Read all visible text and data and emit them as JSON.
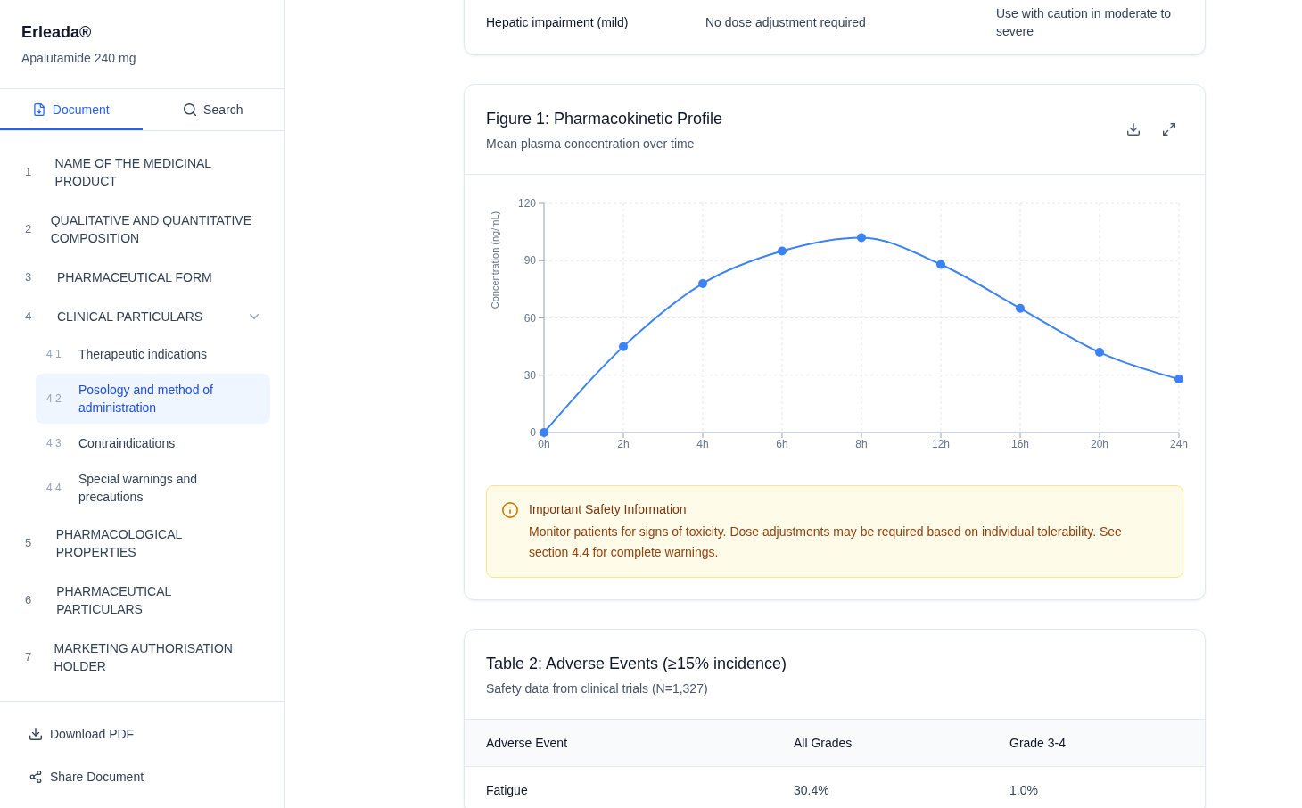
{
  "sidebar": {
    "title": "Erleada®",
    "subtitle": "Apalutamide 240 mg",
    "tabs": [
      {
        "label": "Document",
        "selected": true
      },
      {
        "label": "Search",
        "selected": false
      }
    ],
    "sections": [
      {
        "number": "1",
        "title": "NAME OF THE MEDICINAL PRODUCT",
        "selected": false
      },
      {
        "number": "2",
        "title": "QUALITATIVE AND QUANTITATIVE COMPOSITION",
        "selected": false
      },
      {
        "number": "3",
        "title": "PHARMACEUTICAL FORM",
        "selected": false
      },
      {
        "number": "4",
        "title": "CLINICAL PARTICULARS",
        "selected": false,
        "expanded": true,
        "children": [
          {
            "number": "4.1",
            "title": "Therapeutic indications",
            "selected": false
          },
          {
            "number": "4.2",
            "title": "Posology and method of administration",
            "selected": true
          },
          {
            "number": "4.3",
            "title": "Contraindications",
            "selected": false
          },
          {
            "number": "4.4",
            "title": "Special warnings and precautions",
            "selected": false
          }
        ]
      },
      {
        "number": "5",
        "title": "PHARMACOLOGICAL PROPERTIES",
        "selected": false
      },
      {
        "number": "6",
        "title": "PHARMACEUTICAL PARTICULARS",
        "selected": false
      },
      {
        "number": "7",
        "title": "MARKETING AUTHORISATION HOLDER",
        "selected": false
      }
    ],
    "actions": [
      "Download PDF",
      "Share Document"
    ]
  },
  "table_1": {
    "rows": [
      [
        "Hepatic impairment (mild)",
        "No dose adjustment required",
        "Use with caution in moderate to severe"
      ]
    ]
  },
  "figure": {
    "title": "Figure 1: Pharmacokinetic Profile",
    "subtitle": "Mean plasma concentration over time",
    "chart_data": {
      "type": "line",
      "ylabel": "Concentration (ng/mL)",
      "categories": [
        "0h",
        "2h",
        "4h",
        "6h",
        "8h",
        "12h",
        "16h",
        "20h",
        "24h"
      ],
      "series": [
        {
          "color": "#3b82f6",
          "marker": true,
          "values": [
            0,
            45,
            78,
            95,
            102,
            88,
            65,
            42,
            28
          ]
        }
      ],
      "ylim": [
        0,
        120
      ],
      "yticks": [
        0,
        30,
        60,
        90,
        120
      ],
      "grid": true
    },
    "alert": {
      "title": "Important Safety Information",
      "text": "Monitor patients for signs of toxicity. Dose adjustments may be required based on individual tolerability. See section 4.4 for complete warnings."
    }
  },
  "adverse_events_table": {
    "title": "Table 2: Adverse Events (≥15% incidence)",
    "subtitle": "Safety data from clinical trials (N=1,327)",
    "columns": [
      "Adverse Event",
      "All Grades",
      "Grade 3-4"
    ],
    "rows": [
      [
        "Fatigue",
        "30.4%",
        "1.0%"
      ]
    ]
  }
}
